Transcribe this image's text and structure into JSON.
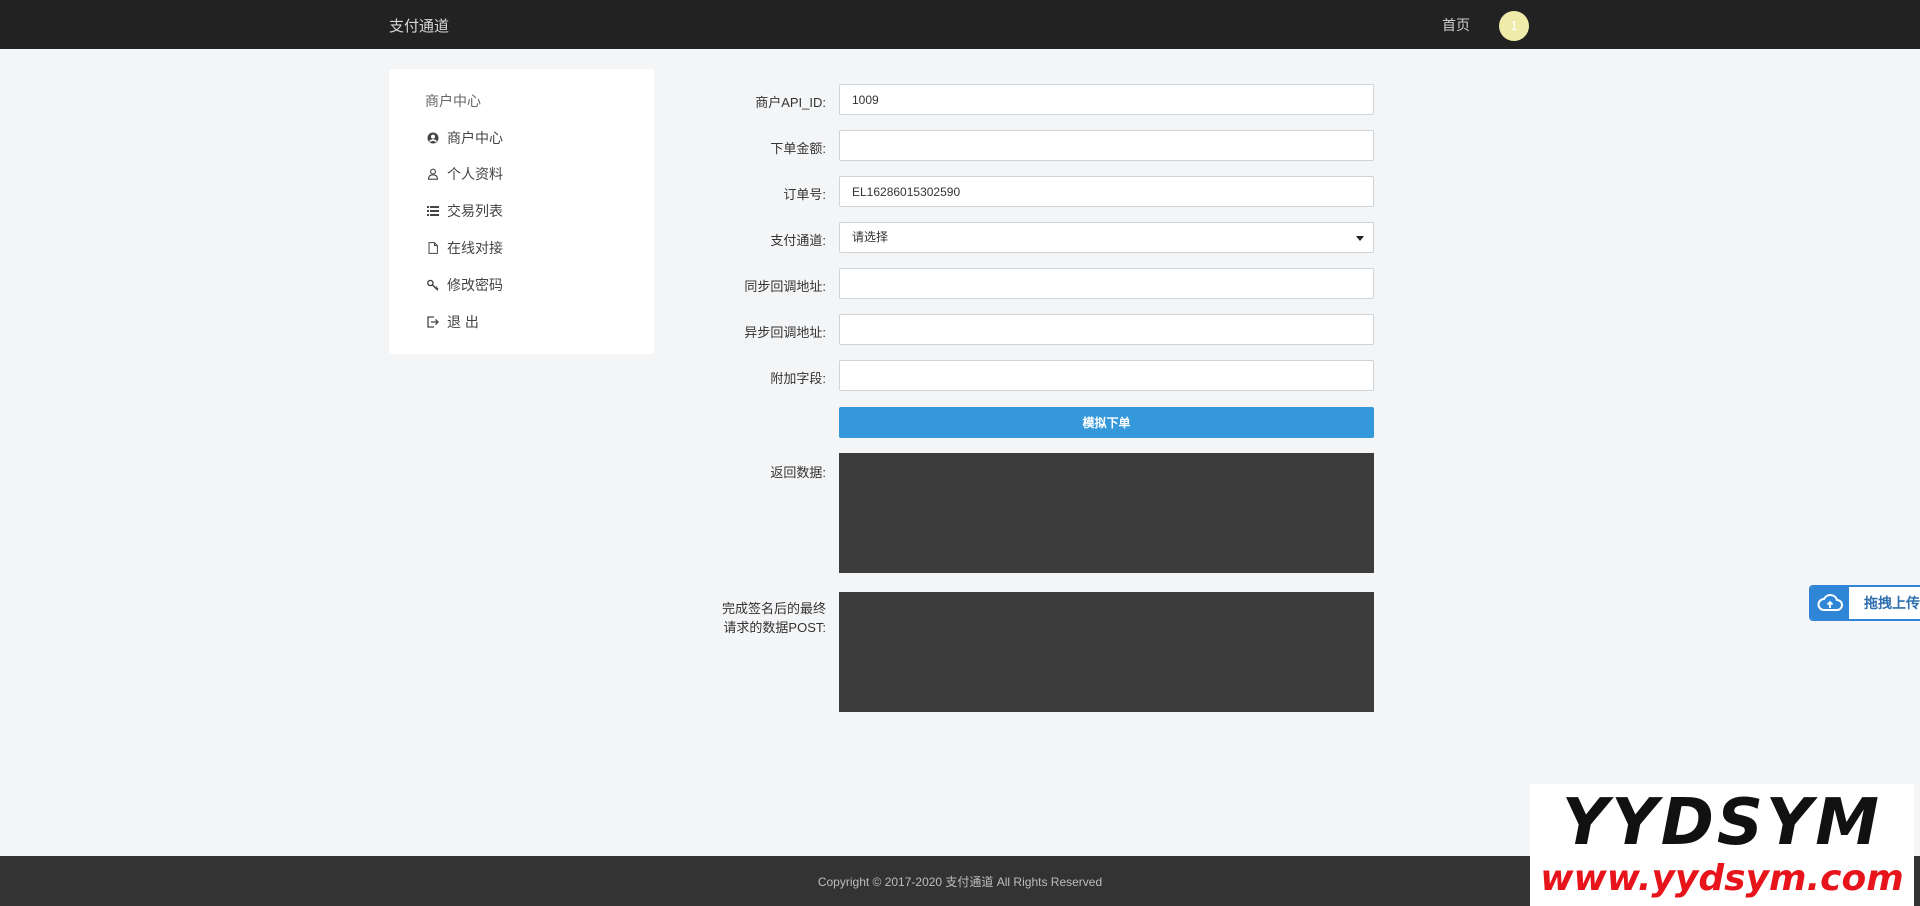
{
  "header": {
    "brand": "支付通道",
    "home_link": "首页",
    "avatar_text": "1",
    "avatar_color": "#efeba9"
  },
  "sidebar": {
    "title": "商户中心",
    "items": [
      {
        "label": "商户中心",
        "icon": "user-circle-icon"
      },
      {
        "label": "个人资料",
        "icon": "user-icon"
      },
      {
        "label": "交易列表",
        "icon": "list-icon"
      },
      {
        "label": "在线对接",
        "icon": "file-icon"
      },
      {
        "label": "修改密码",
        "icon": "key-icon"
      },
      {
        "label": "退 出",
        "icon": "sign-out-icon"
      }
    ]
  },
  "form": {
    "api_id_label": "商户API_ID:",
    "api_id_value": "1009",
    "amount_label": "下单金额:",
    "amount_value": "",
    "order_no_label": "订单号:",
    "order_no_value": "EL16286015302590",
    "channel_label": "支付通道:",
    "channel_selected": "请选择",
    "sync_url_label": "同步回调地址:",
    "sync_url_value": "",
    "async_url_label": "异步回调地址:",
    "async_url_value": "",
    "extra_label": "附加字段:",
    "extra_value": "",
    "submit_label": "模拟下单",
    "return_label": "返回数据:",
    "post_label_line1": "完成签名后的最终",
    "post_label_line2": "请求的数据POST:"
  },
  "footer": {
    "copyright": "Copyright © 2017-2020 支付通道 All Rights Reserved"
  },
  "upload_tab": {
    "label": "拖拽上传",
    "icon": "cloud-upload-icon"
  },
  "watermark": {
    "line1": "YYDSYM",
    "line2": "www.yydsym.com"
  },
  "colors": {
    "nav_bg": "#222222",
    "page_bg": "#f4f5f7",
    "primary": "#3498db",
    "result_bg": "#3c3c3c",
    "footer_bg": "#333333"
  }
}
